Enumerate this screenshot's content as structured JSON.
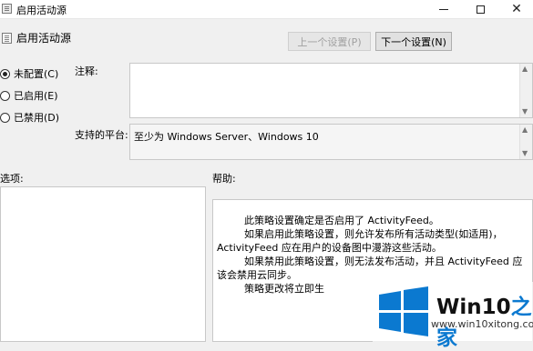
{
  "window": {
    "title": "启用活动源",
    "minimize_icon": "minimize-icon",
    "maximize_icon": "maximize-icon",
    "close_symbol": "✕"
  },
  "header": {
    "policy_name": "启用活动源",
    "prev_button": "上一个设置(P)",
    "next_button": "下一个设置(N)"
  },
  "state_options": [
    {
      "label": "未配置(C)",
      "checked": true
    },
    {
      "label": "已启用(E)",
      "checked": false
    },
    {
      "label": "已禁用(D)",
      "checked": false
    }
  ],
  "comment": {
    "label": "注释:",
    "value": ""
  },
  "platform": {
    "label": "支持的平台:",
    "value": "至少为 Windows Server、Windows 10"
  },
  "options": {
    "label": "选项:"
  },
  "help": {
    "label": "帮助:",
    "lines": [
      "此策略设置确定是否启用了 ActivityFeed。",
      "如果启用此策略设置，则允许发布所有活动类型(如适用)，ActivityFeed 应在用户的设备图中漫游这些活动。",
      "如果禁用此策略设置，则无法发布活动，并且 ActivityFeed 应该会禁用云同步。",
      "策略更改将立即生"
    ]
  },
  "watermark": {
    "brand": "Win10",
    "brand_accent": "之家",
    "url": "www.win10xitong.com",
    "colors": {
      "blue": "#0b79d0"
    }
  }
}
